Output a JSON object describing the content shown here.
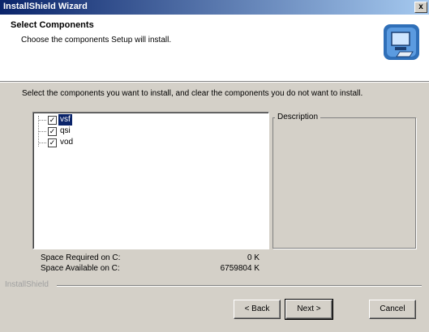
{
  "window": {
    "title": "InstallShield Wizard",
    "close_glyph": "x"
  },
  "header": {
    "title": "Select Components",
    "subtitle": "Choose the components Setup will install.",
    "icon": "computer-install-icon"
  },
  "instructions": "Select the components you want to install, and clear the components you do not want to install.",
  "components": [
    {
      "label": "vsf",
      "checked": true,
      "selected": true
    },
    {
      "label": "qsi",
      "checked": true,
      "selected": false
    },
    {
      "label": "vod",
      "checked": true,
      "selected": false
    }
  ],
  "description_label": "Description",
  "space": {
    "required_label": "Space Required on  C:",
    "required_value": "0 K",
    "available_label": "Space Available on  C:",
    "available_value": "6759804 K"
  },
  "brand": "InstallShield",
  "buttons": {
    "back": "< Back",
    "next": "Next >",
    "cancel": "Cancel"
  },
  "colors": {
    "titlebar_start": "#0a246a",
    "titlebar_end": "#a6caf0",
    "dialog_bg": "#d4d0c8",
    "selection": "#0a246a"
  }
}
